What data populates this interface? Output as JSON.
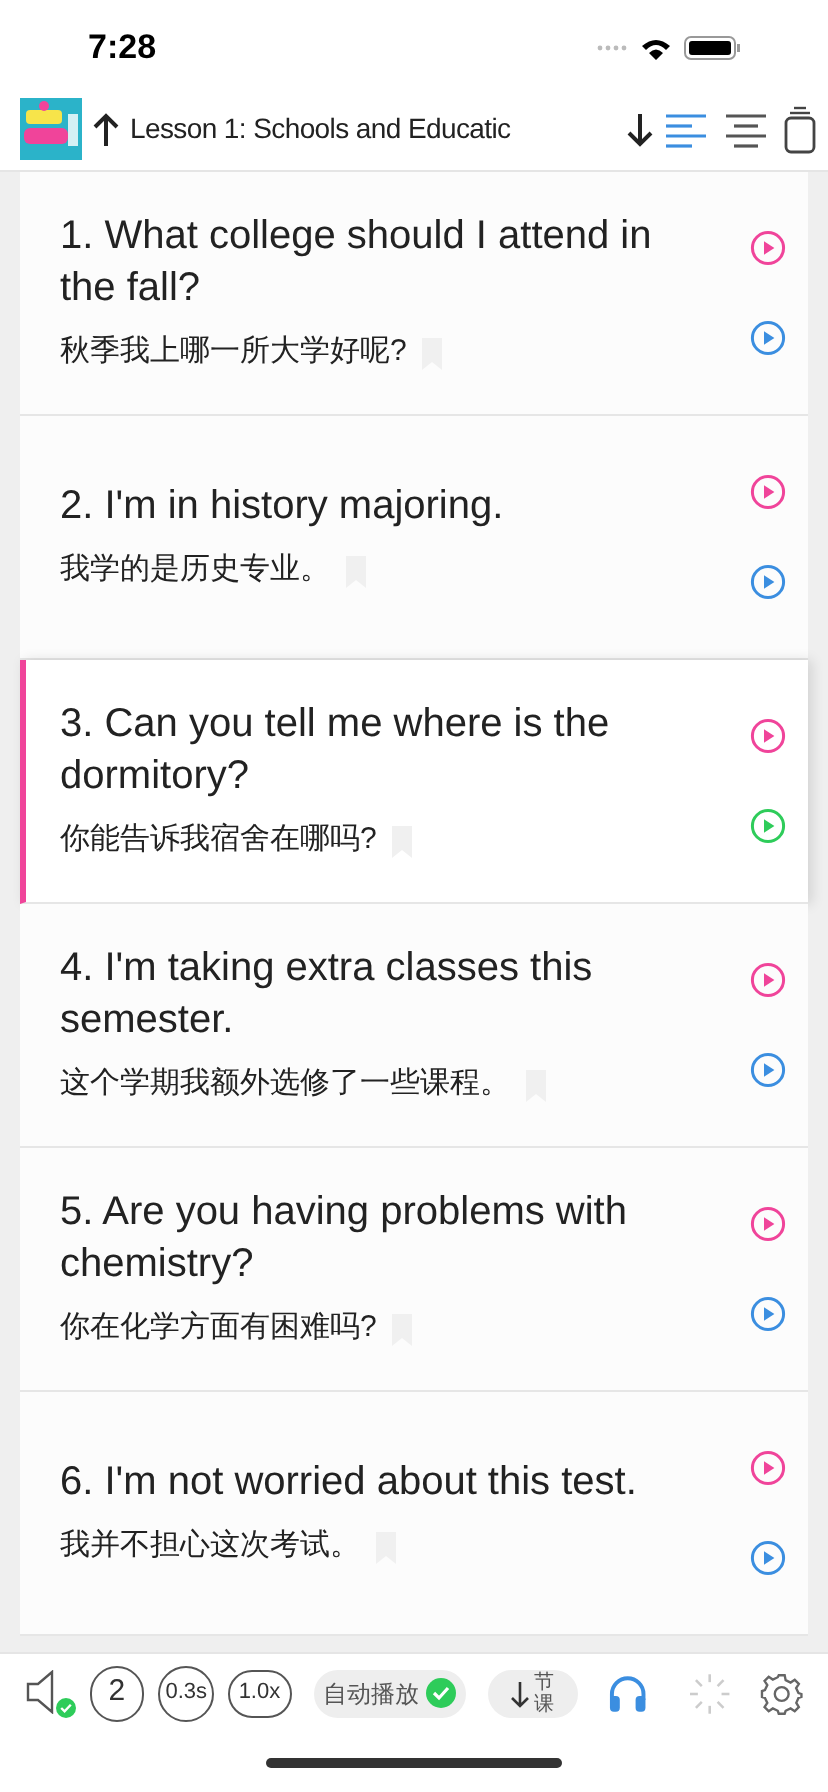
{
  "status_bar": {
    "time": "7:28"
  },
  "header": {
    "title": "Lesson 1: Schools and Educatic",
    "view_modes": [
      {
        "selected": true
      },
      {
        "selected": false
      }
    ]
  },
  "sentences": [
    {
      "english": "1. What college should I attend in the fall?",
      "chinese": "秋季我上哪一所大学好呢?",
      "selected": false
    },
    {
      "english": "2. I'm in history majoring.",
      "chinese": "我学的是历史专业。",
      "selected": false
    },
    {
      "english": "3. Can you tell me where is the dormitory?",
      "chinese": "你能告诉我宿舍在哪吗?",
      "selected": true
    },
    {
      "english": "4. I'm taking extra classes this semester.",
      "chinese": "这个学期我额外选修了一些课程。",
      "selected": false
    },
    {
      "english": "5. Are you having problems with chemistry?",
      "chinese": "你在化学方面有困难吗?",
      "selected": false
    },
    {
      "english": "6. I'm not worried about this test.",
      "chinese": "我并不担心这次考试。",
      "selected": false
    }
  ],
  "toolbar": {
    "sound_on": true,
    "repeat": "2",
    "interval": "0.3s",
    "speed": "1.0x",
    "autoplay": {
      "label": "自动播放",
      "checked": true
    },
    "next_label": "节课"
  }
}
